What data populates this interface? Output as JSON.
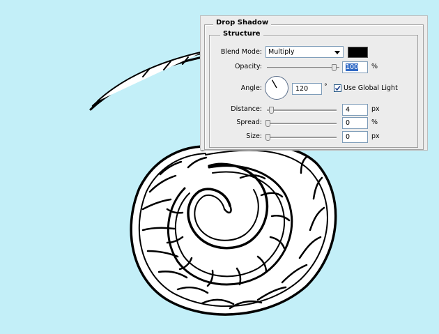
{
  "panel": {
    "group_title": "Drop Shadow",
    "section_title": "Structure",
    "blend_mode": {
      "label": "Blend Mode:",
      "value": "Multiply",
      "swatch_color": "#000000"
    },
    "opacity": {
      "label": "Opacity:",
      "value": "100",
      "unit": "%",
      "level": 1.0
    },
    "angle": {
      "label": "Angle:",
      "value": "120",
      "unit": "°",
      "degrees": 120
    },
    "global_light": {
      "label": "Use Global Light",
      "checked": true
    },
    "distance": {
      "label": "Distance:",
      "value": "4",
      "unit": "px",
      "level": 0.0
    },
    "spread": {
      "label": "Spread:",
      "value": "0",
      "unit": "%",
      "level": 0.0
    },
    "size": {
      "label": "Size:",
      "value": "0",
      "unit": "px",
      "level": 0.0
    }
  },
  "colors": {
    "canvas_background": "#c3eff8",
    "panel_background": "#ececec",
    "selection": "#316ac5"
  }
}
